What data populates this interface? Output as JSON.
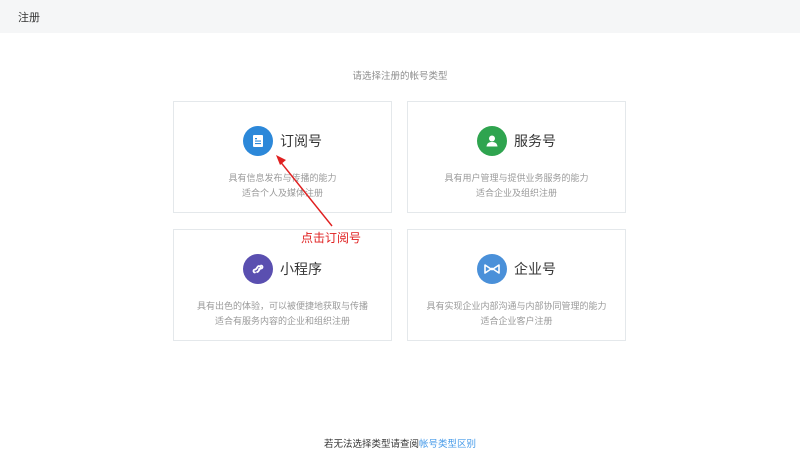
{
  "header": {
    "title": "注册"
  },
  "main": {
    "subtitle": "请选择注册的帐号类型",
    "cards": [
      {
        "title": "订阅号",
        "desc_line1": "具有信息发布与传播的能力",
        "desc_line2": "适合个人及媒体注册",
        "icon": "subscription-doc-icon",
        "color": "#2c88d9"
      },
      {
        "title": "服务号",
        "desc_line1": "具有用户管理与提供业务服务的能力",
        "desc_line2": "适合企业及组织注册",
        "icon": "user-person-icon",
        "color": "#2fa44f"
      },
      {
        "title": "小程序",
        "desc_line1": "具有出色的体验，可以被便捷地获取与传播",
        "desc_line2": "适合有服务内容的企业和组织注册",
        "icon": "mini-program-link-icon",
        "color": "#5a4fb0"
      },
      {
        "title": "企业号",
        "desc_line1": "具有实现企业内部沟通与内部协同管理的能力",
        "desc_line2": "适合企业客户注册",
        "icon": "enterprise-bowtie-icon",
        "color": "#4a90d9"
      }
    ]
  },
  "footer": {
    "text": "若无法选择类型请查阅",
    "link_label": "帐号类型区别"
  },
  "annotation": {
    "label": "点击订阅号",
    "color": "#e02020"
  }
}
